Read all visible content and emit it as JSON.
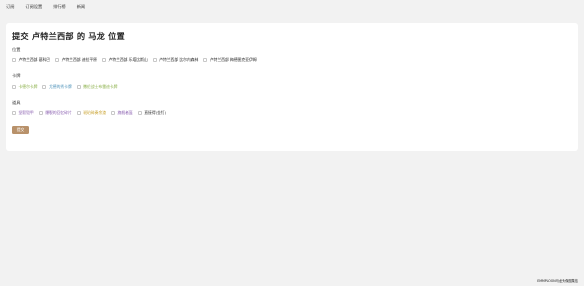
{
  "nav": {
    "items": [
      "订阅",
      "订阅设置",
      "排行榜",
      "新闻"
    ]
  },
  "form": {
    "title": "提交 卢特兰西部 的 马龙 位置",
    "location_label": "位置",
    "locations": [
      "卢特兰西部 墓科巴",
      "卢特兰西部 迪拉平原",
      "卢特兰西部 乐塔比斯山",
      "卢特兰西部 比尔内森林",
      "卢特兰西部 梅德图克亚伊姆"
    ],
    "card_label": "卡牌",
    "cards": [
      {
        "label": "卡德尔卡牌",
        "color": "#8bb04a"
      },
      {
        "label": "尤德的秀卡牌",
        "color": "#4a90b8"
      },
      {
        "label": "撒伦战士布雷迪卡牌",
        "color": "#8bb04a"
      }
    ],
    "item_label": "道具",
    "items": [
      {
        "label": "坚毅铠甲",
        "color": "#8a5fb0"
      },
      {
        "label": "爆裂的回忆碎片",
        "color": "#8a5fb0"
      },
      {
        "label": "琥珀碎奏余渣",
        "color": "#c8a02a"
      },
      {
        "label": "旗舰者盔",
        "color": "#8a5fb0"
      },
      {
        "label": "直接得(金钉)",
        "color": "#333333"
      }
    ],
    "submit_label": "提交"
  },
  "footer": {
    "text": "EMMPLOON马龙头像图集信"
  }
}
